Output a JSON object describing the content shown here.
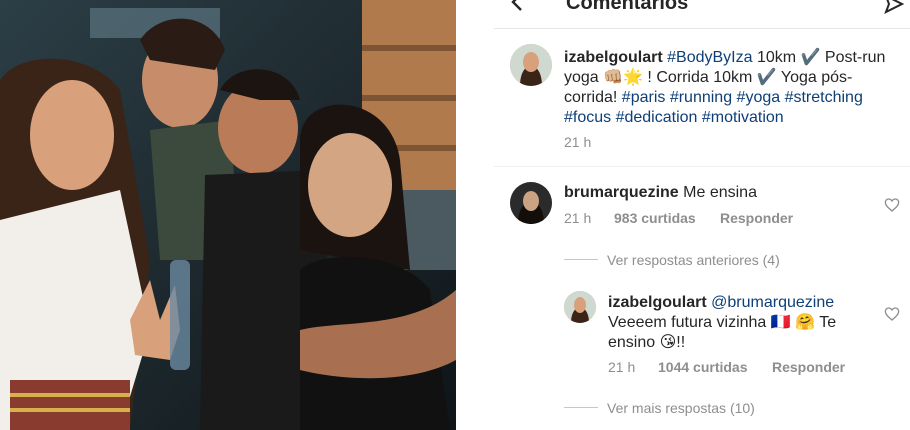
{
  "header": {
    "back_icon": "back-arrow-icon",
    "title": "Comentários",
    "send_icon": "send-icon"
  },
  "caption": {
    "username": "izabelgoulart",
    "tag1": "#BodyByIza",
    "text1": " 10km ✔️ Post-run yoga 👊🏼🌟 ! Corrida 10km ✔️ Yoga pós-corrida! ",
    "tags2": "#paris #running #yoga #stretching #focus #dedication #motivation",
    "time": "21 h"
  },
  "comment": {
    "username": "brumarquezine",
    "text": "Me ensina",
    "time": "21 h",
    "likes": "983 curtidas",
    "reply": "Responder"
  },
  "previous_replies": "Ver respostas anteriores (4)",
  "reply": {
    "username": "izabelgoulart",
    "mention": "@brumarquezine",
    "text": "Veeeem futura vizinha 🇫🇷 🤗 Te ensino 😘!!",
    "time": "21 h",
    "likes": "1044 curtidas",
    "reply": "Responder"
  },
  "more_replies": "Ver mais respostas (10)",
  "colors": {
    "hashtag": "#0e3f77",
    "muted": "#8e8e8e",
    "text": "#262626"
  }
}
